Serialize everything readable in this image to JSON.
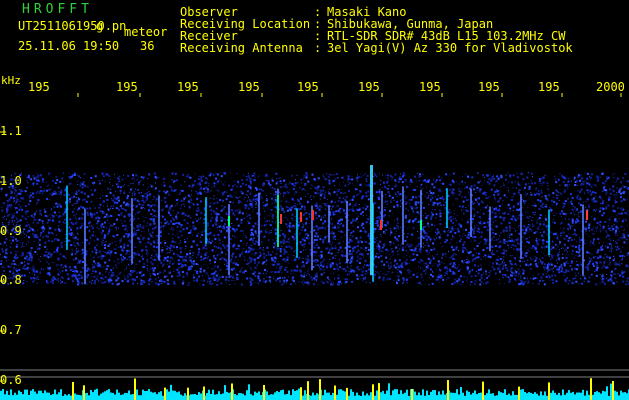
{
  "header": {
    "app_title": "HROFFT",
    "file_name": "UT2511061950.pn",
    "file_suffix": "g",
    "mode": "meteor",
    "datetime": "25.11.06 19:50",
    "count": "36",
    "info": [
      {
        "label": "Observer",
        "value": "Masaki Kano"
      },
      {
        "label": "Receiving Location",
        "value": "Shibukawa, Gunma, Japan"
      },
      {
        "label": "Receiver",
        "value": "RTL-SDR SDR# 43dB L15 103.2MHz CW"
      },
      {
        "label": "Receiving Antenna",
        "value": "3el Yagi(V) Az 330 for Vladivostok"
      }
    ]
  },
  "time_axis": {
    "ticks": [
      "195",
      "195",
      "195",
      "195",
      "195",
      "195",
      "195",
      "195",
      "195",
      "2000"
    ]
  },
  "freq_axis": {
    "unit": "kHz",
    "ticks": [
      "1.1",
      "1.0",
      "0.9",
      "0.8",
      "0.7",
      "0.6"
    ]
  },
  "colors": {
    "text": "#ffff00",
    "title": "#2fd13a",
    "background": "#000000",
    "noise": "#1e2ad8",
    "level": "#00e5ff",
    "event": "#ffff00"
  }
}
